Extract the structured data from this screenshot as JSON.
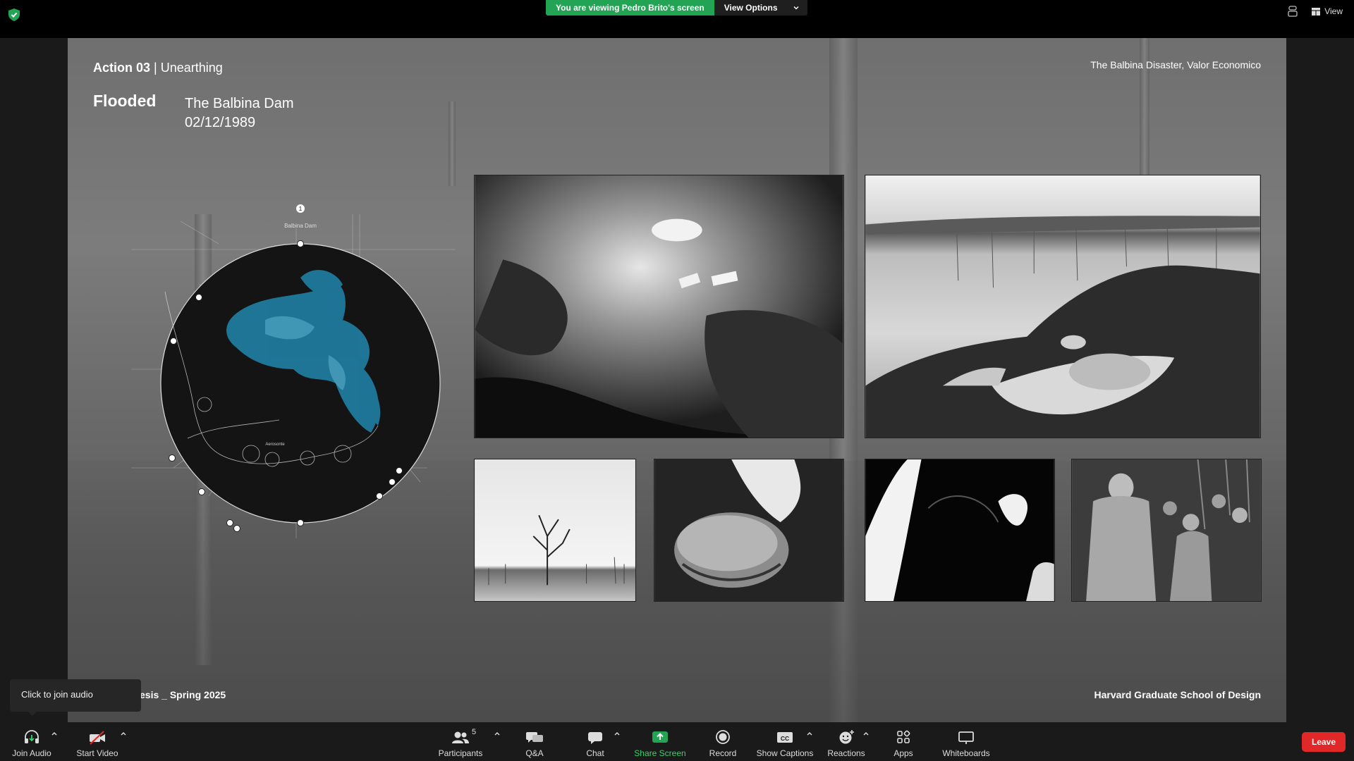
{
  "banner": {
    "viewing_text": "You are viewing Pedro Brito's screen",
    "view_options_label": "View Options"
  },
  "top_right": {
    "view_label": "View"
  },
  "slide": {
    "action_bold": "Action 03",
    "action_rest": " | Unearthing",
    "flooded": "Flooded",
    "dam_name": "The Balbina Dam",
    "dam_date": "02/12/1989",
    "source": "The Balbina Disaster, Valor Economico",
    "thesis": "esis _ Spring 2025",
    "school": "Harvard Graduate School of Design",
    "map": {
      "marker_number": "1",
      "marker_label": "Balbina Dam",
      "center_label": "Aerosonte"
    }
  },
  "tooltip": {
    "text": "Click to join audio"
  },
  "toolbar": {
    "join_audio": "Join Audio",
    "start_video": "Start Video",
    "participants": "Participants",
    "participants_count": "5",
    "qa": "Q&A",
    "chat": "Chat",
    "share_screen": "Share Screen",
    "record": "Record",
    "show_captions": "Show Captions",
    "captions_icon_text": "CC",
    "reactions": "Reactions",
    "apps": "Apps",
    "whiteboards": "Whiteboards",
    "leave": "Leave"
  },
  "colors": {
    "share_green": "#23a455",
    "leave_red": "#e02828",
    "map_water": "#1f7fa3"
  }
}
